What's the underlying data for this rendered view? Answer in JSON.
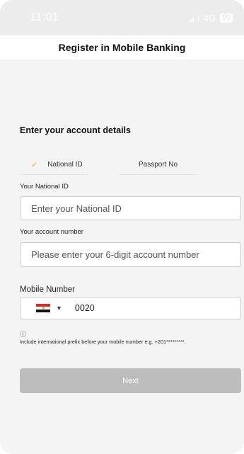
{
  "status_bar": {
    "time": "11:01",
    "network": "4G",
    "battery": "90"
  },
  "header": {
    "title": "Register in Mobile Banking"
  },
  "form": {
    "section_title": "Enter your account details",
    "tabs": [
      {
        "label": "National ID",
        "selected": true
      },
      {
        "label": "Passport No",
        "selected": false
      }
    ],
    "national_id": {
      "label": "Your National ID",
      "placeholder": "Enter your National ID"
    },
    "account_number": {
      "label": "Your account number",
      "placeholder": "Please enter your 6-digit account number"
    },
    "mobile": {
      "label": "Mobile Number",
      "country_prefix": "0020",
      "flag_icon": "egypt-flag-icon"
    },
    "info": {
      "icon_glyph": "ⓘ",
      "text": "Include international prefix before your mobile number e.g. +201*********."
    },
    "next_label": "Next"
  },
  "colors": {
    "accent_check": "#f0a050",
    "button_disabled": "#bdbdbd",
    "background": "#f4f4f4"
  }
}
